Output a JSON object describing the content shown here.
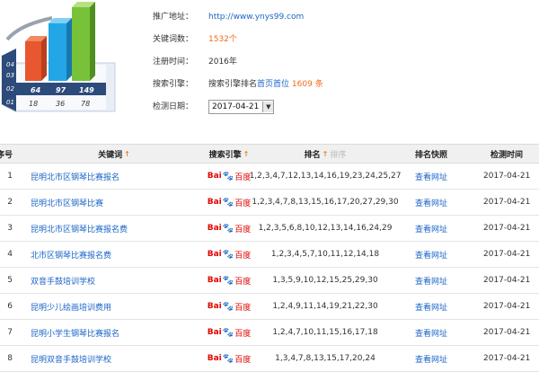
{
  "logo": {
    "levels": [
      "04",
      "03",
      "02",
      "01"
    ],
    "values_top": [
      "64",
      "97",
      "149"
    ],
    "values_bottom": [
      "18",
      "36",
      "78"
    ]
  },
  "info": {
    "url_label": "推广地址：",
    "url": "http://www.ynys99.com",
    "kw_label": "关键词数：",
    "kw_count": "1532",
    "kw_unit": "个",
    "reg_label": "注册时间：",
    "reg_year": "2016年",
    "engine_label": "搜索引擎：",
    "engine_text": "搜索引擎排名",
    "engine_link": "首页首位",
    "engine_count": "1609",
    "engine_unit": "条",
    "date_label": "检测日期：",
    "date_value": "2017-04-21"
  },
  "table": {
    "headers": {
      "idx": "序号",
      "kw": "关键词",
      "engine": "搜索引擎",
      "rank": "排名",
      "rank_extra": "排序",
      "snap": "排名快照",
      "date": "检测时间"
    },
    "rows": [
      {
        "idx": "1",
        "kw": "昆明北市区钢琴比赛报名",
        "rank": "1,2,3,4,7,12,13,14,16,19,23,24,25,27",
        "snap": "查看网址",
        "date": "2017-04-21"
      },
      {
        "idx": "2",
        "kw": "昆明北市区钢琴比赛",
        "rank": "1,2,3,4,7,8,13,15,16,17,20,27,29,30",
        "snap": "查看网址",
        "date": "2017-04-21"
      },
      {
        "idx": "3",
        "kw": "昆明北市区钢琴比赛报名费",
        "rank": "1,2,3,5,6,8,10,12,13,14,16,24,29",
        "snap": "查看网址",
        "date": "2017-04-21"
      },
      {
        "idx": "4",
        "kw": "北市区钢琴比赛报名费",
        "rank": "1,2,3,4,5,7,10,11,12,14,18",
        "snap": "查看网址",
        "date": "2017-04-21"
      },
      {
        "idx": "5",
        "kw": "双音手鼓培训学校",
        "rank": "1,3,5,9,10,12,15,25,29,30",
        "snap": "查看网址",
        "date": "2017-04-21"
      },
      {
        "idx": "6",
        "kw": "昆明少儿绘画培训费用",
        "rank": "1,2,4,9,11,14,19,21,22,30",
        "snap": "查看网址",
        "date": "2017-04-21"
      },
      {
        "idx": "7",
        "kw": "昆明小学生钢琴比赛报名",
        "rank": "1,2,4,7,10,11,15,16,17,18",
        "snap": "查看网址",
        "date": "2017-04-21"
      },
      {
        "idx": "8",
        "kw": "昆明双音手鼓培训学校",
        "rank": "1,3,4,7,8,13,15,17,20,24",
        "snap": "查看网址",
        "date": "2017-04-21"
      }
    ]
  },
  "engine_logo": {
    "bai": "Bai",
    "paw": "🐾",
    "cn": "百度"
  },
  "colors": {
    "link": "#1a64c8",
    "orange": "#f06a1c",
    "header_bg": "#f0f0f0"
  },
  "icons": {
    "sort": "up-arrow-icon",
    "select_arrow": "dropdown-arrow-icon"
  }
}
